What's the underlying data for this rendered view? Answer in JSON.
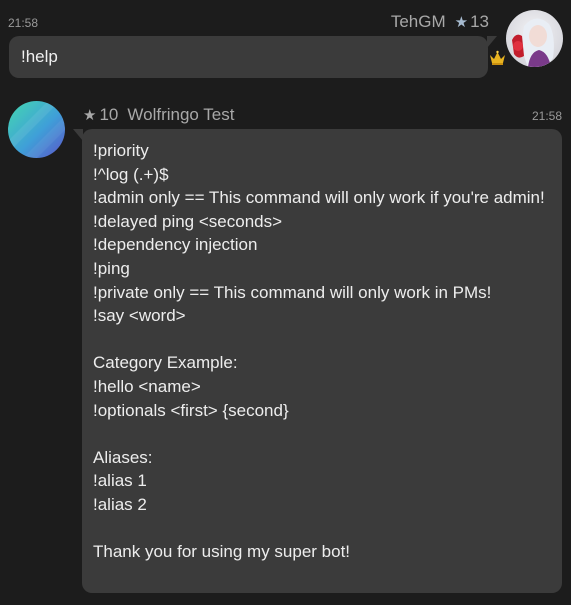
{
  "outgoing": {
    "time": "21:58",
    "username": "TehGM",
    "level": "13",
    "text": "!help",
    "avatar_icon": "user-avatar",
    "badge_icon": "crown-icon"
  },
  "incoming": {
    "level": "10",
    "username": "Wolfringo Test",
    "time": "21:58",
    "avatar_icon": "bot-avatar",
    "lines": [
      "!priority",
      "!^log (.+)$",
      "!admin only == This command will only work if you're admin!",
      "!delayed ping <seconds>",
      "!dependency injection",
      "!ping",
      "!private only == This command will only work in PMs!",
      "!say <word>",
      "",
      "Category Example:",
      "!hello <name>",
      "!optionals <first> {second}",
      "",
      "Aliases:",
      "!alias 1",
      "!alias 2",
      "",
      "Thank you for using my super bot!"
    ]
  },
  "colors": {
    "background": "#1c1c1c",
    "bubble": "#3b3b3b",
    "star_outgoing": "#a7bbd0",
    "text": "#ededed",
    "meta_text": "#a8a8a8"
  }
}
